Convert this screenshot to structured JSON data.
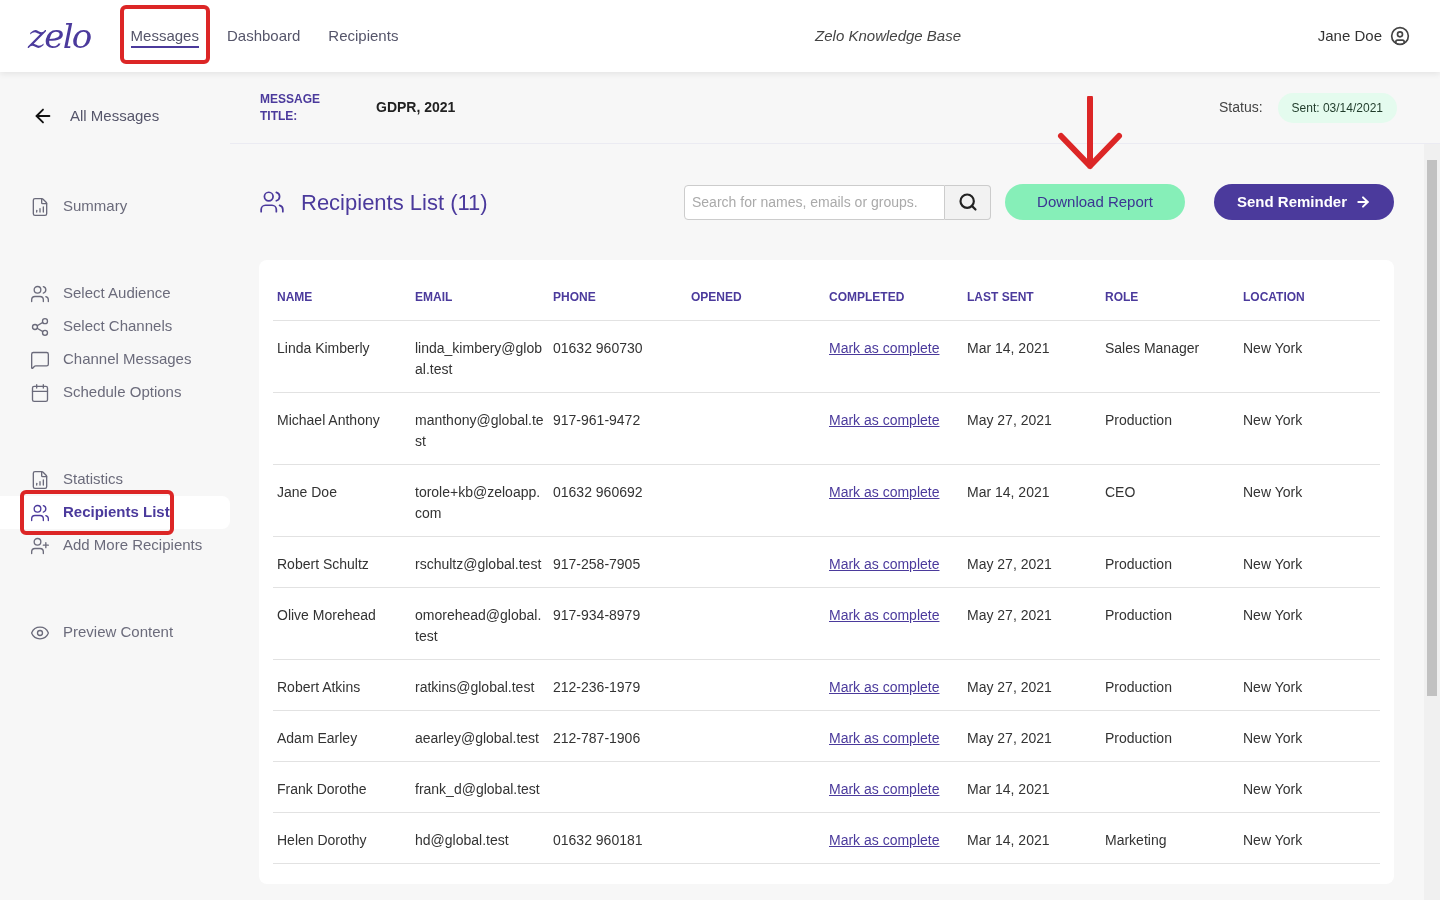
{
  "header": {
    "logo": "zelo",
    "nav": [
      {
        "label": "Messages",
        "selected": true,
        "highlighted": true
      },
      {
        "label": "Dashboard",
        "selected": false,
        "highlighted": false
      },
      {
        "label": "Recipients",
        "selected": false,
        "highlighted": false
      }
    ],
    "center_title": "Zelo Knowledge Base",
    "user": "Jane Doe"
  },
  "sidebar": {
    "back": "All Messages",
    "groups": [
      [
        {
          "label": "Summary",
          "kind": "report",
          "selected": false,
          "highlighted": false
        }
      ],
      [
        {
          "label": "Select Audience",
          "kind": "users",
          "selected": false,
          "highlighted": false
        },
        {
          "label": "Select Channels",
          "kind": "share",
          "selected": false,
          "highlighted": false
        },
        {
          "label": "Channel Messages",
          "kind": "chat",
          "selected": false,
          "highlighted": false
        },
        {
          "label": "Schedule Options",
          "kind": "calendar",
          "selected": false,
          "highlighted": false
        }
      ],
      [
        {
          "label": "Statistics",
          "kind": "report",
          "selected": false,
          "highlighted": false
        },
        {
          "label": "Recipients List",
          "kind": "users",
          "selected": true,
          "highlighted": true
        },
        {
          "label": "Add More Recipients",
          "kind": "user-plus",
          "selected": false,
          "highlighted": false
        }
      ],
      [
        {
          "label": "Preview Content",
          "kind": "eye",
          "selected": false,
          "highlighted": false
        }
      ]
    ]
  },
  "message_bar": {
    "label": "MESSAGE TITLE:",
    "title": "GDPR, 2021",
    "status_label": "Status:",
    "status": "Sent: 03/14/2021"
  },
  "list": {
    "title": "Recipients List (11)",
    "search": {
      "placeholder": "Search for names, emails or groups."
    },
    "download_button": {
      "label": "Download Report",
      "pointed": true
    },
    "reminder_button": "Send Reminder",
    "table": {
      "columns": [
        "NAME",
        "EMAIL",
        "PHONE",
        "OPENED",
        "COMPLETED",
        "LAST SENT",
        "ROLE",
        "LOCATION"
      ],
      "rows": [
        [
          "Linda Kimberly",
          "linda_kimbery@global.test",
          "01632 960730",
          "",
          "Mark as complete",
          "Mar 14, 2021",
          "Sales Manager",
          "New York"
        ],
        [
          "Michael Anthony",
          "manthony@global.test",
          "917-961-9472",
          "",
          "Mark as complete",
          "May 27, 2021",
          "Production",
          "New York"
        ],
        [
          "Jane Doe",
          "torole+kb@zeloapp.com",
          "01632 960692",
          "",
          "Mark as complete",
          "Mar 14, 2021",
          "CEO",
          "New York"
        ],
        [
          "Robert Schultz",
          "rschultz@global.test",
          "917-258-7905",
          "",
          "Mark as complete",
          "May 27, 2021",
          "Production",
          "New York"
        ],
        [
          "Olive Morehead",
          "omorehead@global.test",
          "917-934-8979",
          "",
          "Mark as complete",
          "May 27, 2021",
          "Production",
          "New York"
        ],
        [
          "Robert Atkins",
          "ratkins@global.test",
          "212-236-1979",
          "",
          "Mark as complete",
          "May 27, 2021",
          "Production",
          "New York"
        ],
        [
          "Adam Earley",
          "aearley@global.test",
          "212-787-1906",
          "",
          "Mark as complete",
          "May 27, 2021",
          "Production",
          "New York"
        ],
        [
          "Frank Dorothe",
          "frank_d@global.test",
          "",
          "",
          "Mark as complete",
          "Mar 14, 2021",
          "",
          "New York"
        ],
        [
          "Helen Dorothy",
          "hd@global.test",
          "01632 960181",
          "",
          "Mark as complete",
          "Mar 14, 2021",
          "Marketing",
          "New York"
        ]
      ]
    }
  }
}
